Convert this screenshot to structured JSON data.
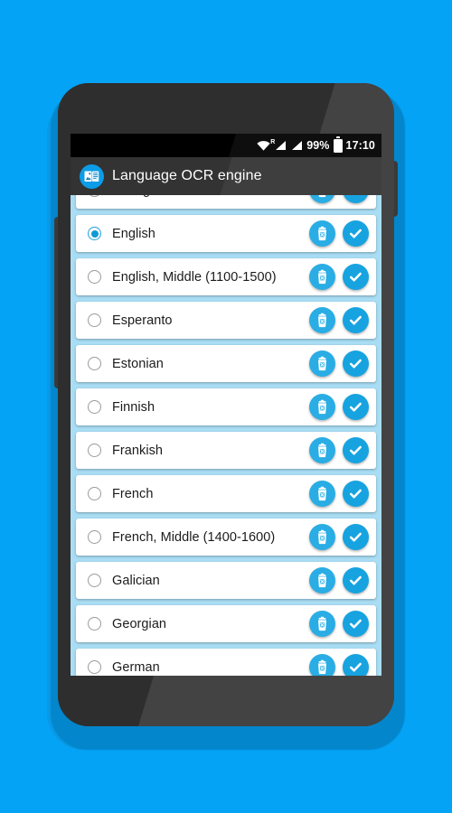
{
  "theme": {
    "page_background": "#05a3f5",
    "accent": "#17a3e0",
    "list_background": "#a9ddf4",
    "action_bar": "#333333",
    "card": "#ffffff"
  },
  "status_bar": {
    "wifi_icon": "wifi-icon",
    "roaming_label": "R",
    "signal_icon_1": "signal-roaming-icon",
    "signal_icon_2": "signal-icon",
    "battery_percent": "99%",
    "battery_icon": "battery-full-icon",
    "time": "17:10"
  },
  "action_bar": {
    "app_icon": "language-ocr-app-icon",
    "title": "Language OCR engine"
  },
  "list": {
    "row_delete_icon": "trash-delete-icon",
    "row_confirm_icon": "check-confirm-icon",
    "items": [
      {
        "label": "Dzongkha",
        "selected": false,
        "partial": true
      },
      {
        "label": "English",
        "selected": true,
        "partial": false
      },
      {
        "label": "English, Middle (1100-1500)",
        "selected": false,
        "partial": false
      },
      {
        "label": "Esperanto",
        "selected": false,
        "partial": false
      },
      {
        "label": "Estonian",
        "selected": false,
        "partial": false
      },
      {
        "label": "Finnish",
        "selected": false,
        "partial": false
      },
      {
        "label": "Frankish",
        "selected": false,
        "partial": false
      },
      {
        "label": "French",
        "selected": false,
        "partial": false
      },
      {
        "label": "French, Middle (1400-1600)",
        "selected": false,
        "partial": false
      },
      {
        "label": "Galician",
        "selected": false,
        "partial": false
      },
      {
        "label": "Georgian",
        "selected": false,
        "partial": false
      },
      {
        "label": "German",
        "selected": false,
        "partial": true
      }
    ]
  },
  "device": {
    "camera_icon": "front-camera-icon",
    "sensor_icon": "proximity-sensor-icon",
    "power_button": "power-button",
    "volume_button": "volume-button"
  }
}
